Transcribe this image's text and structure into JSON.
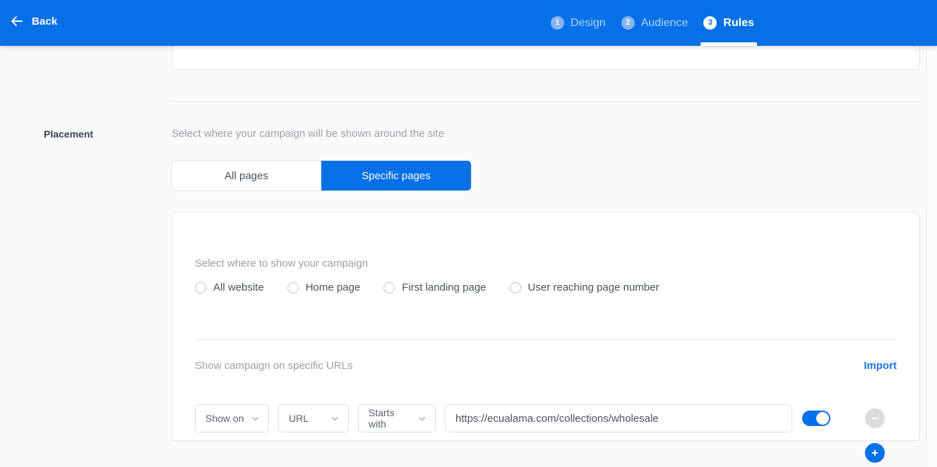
{
  "header": {
    "back_label": "Back",
    "back_icon": "arrow-left-icon",
    "steps": [
      {
        "num": "1",
        "label": "Design",
        "state": "done"
      },
      {
        "num": "2",
        "label": "Audience",
        "state": "done"
      },
      {
        "num": "3",
        "label": "Rules",
        "state": "active"
      }
    ]
  },
  "placement": {
    "section_label": "Placement",
    "description": "Select where your campaign will be shown around the site",
    "segmented": {
      "all_pages": "All pages",
      "specific_pages": "Specific pages",
      "selected": "Specific pages"
    }
  },
  "url_card": {
    "heading": "Select where to show your campaign",
    "radios": [
      {
        "label": "All website",
        "selected": false
      },
      {
        "label": "Home page",
        "selected": false
      },
      {
        "label": "First landing page",
        "selected": false
      },
      {
        "label": "User reaching page number",
        "selected": false
      }
    ],
    "urls_heading": "Show campaign on specific URLs",
    "import_label": "Import",
    "rule": {
      "action": "Show on",
      "target": "URL",
      "match": "Starts with",
      "url_value": "https://ecualama.com/collections/wholesale",
      "url_placeholder": "Enter URL",
      "enabled": true
    },
    "remove_icon": "minus-icon",
    "add_icon": "plus-icon"
  },
  "colors": {
    "brand_blue": "#0570e8",
    "link_blue": "#1f6fe5",
    "page_bg": "#fafafa",
    "muted_text": "#9b9fa8"
  }
}
